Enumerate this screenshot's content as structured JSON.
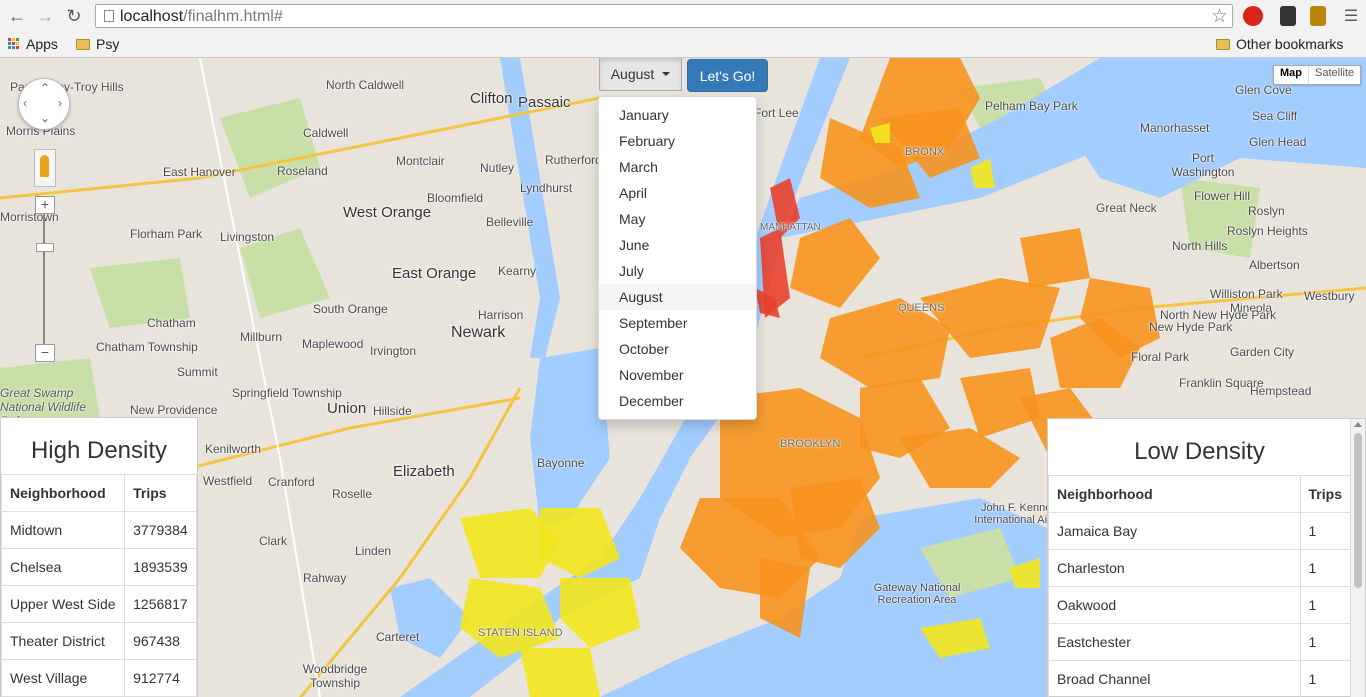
{
  "browser": {
    "url_host": "localhost",
    "url_path": "/finalhm.html#",
    "bookmarks": [
      {
        "label": "Apps"
      },
      {
        "label": "Psy"
      }
    ],
    "other_bookmarks": "Other bookmarks"
  },
  "controls": {
    "month_selected": "August",
    "go_label": "Let's Go!",
    "months": [
      "January",
      "February",
      "March",
      "April",
      "May",
      "June",
      "July",
      "August",
      "September",
      "October",
      "November",
      "December"
    ],
    "map_type": [
      "Map",
      "Satellite"
    ]
  },
  "high_density": {
    "title": "High Density",
    "columns": [
      "Neighborhood",
      "Trips"
    ],
    "rows": [
      [
        "Midtown",
        "3779384"
      ],
      [
        "Chelsea",
        "1893539"
      ],
      [
        "Upper West Side",
        "1256817"
      ],
      [
        "Theater District",
        "967438"
      ],
      [
        "West Village",
        "912774"
      ]
    ]
  },
  "low_density": {
    "title": "Low Density",
    "columns": [
      "Neighborhood",
      "Trips"
    ],
    "rows": [
      [
        "Jamaica Bay",
        "1"
      ],
      [
        "Charleston",
        "1"
      ],
      [
        "Oakwood",
        "1"
      ],
      [
        "Eastchester",
        "1"
      ],
      [
        "Broad Channel",
        "1"
      ]
    ]
  },
  "map_labels": [
    "Parsippany-Troy Hills",
    "North Caldwell",
    "Clifton",
    "Passaic",
    "Morris Plains",
    "Caldwell",
    "Nutley",
    "Montclair",
    "East Hanover",
    "Roseland",
    "Rutherford",
    "Lyndhurst",
    "West Orange",
    "Bloomfield",
    "Belleville",
    "Florham Park",
    "Livingston",
    "East Orange",
    "Kearny",
    "Newark",
    "Harrison",
    "South Orange",
    "Millburn",
    "Maplewood",
    "Irvington",
    "Chatham",
    "Chatham Township",
    "Summit",
    "Springfield Township",
    "Union",
    "Hillside",
    "New Providence",
    "Kenilworth",
    "Elizabeth",
    "Bayonne",
    "Cranford",
    "Roselle",
    "Westfield",
    "Linden",
    "Clark",
    "Rahway",
    "Carteret",
    "Woodbridge Township",
    "Great Swamp National Wildlife Refuge",
    "Morristown",
    "Fort Lee",
    "Bronx",
    "Pelham Bay Park",
    "Glen Cove",
    "Sea Cliff",
    "Manorhasset",
    "Port Washington",
    "Glen Head",
    "Flower Hill",
    "Great Neck",
    "Roslyn",
    "Roslyn Heights",
    "North Hills",
    "Albertson",
    "Williston Park",
    "Mineola",
    "Westbury",
    "New Hyde Park",
    "North New Hyde Park",
    "Floral Park",
    "Garden City",
    "Franklin Square",
    "Hempstead",
    "Queens",
    "Brooklyn",
    "Gateway National Recreation Area",
    "John F. Kennedy International Airport",
    "Staten Island",
    "Manhattan"
  ],
  "colors": {
    "high": "#f7931e",
    "mid": "#e8412c",
    "low": "#f2e51d",
    "water": "#a3ccff",
    "land": "#e8e4dc",
    "park": "#c8dfa8",
    "button_primary": "#337ab7"
  }
}
